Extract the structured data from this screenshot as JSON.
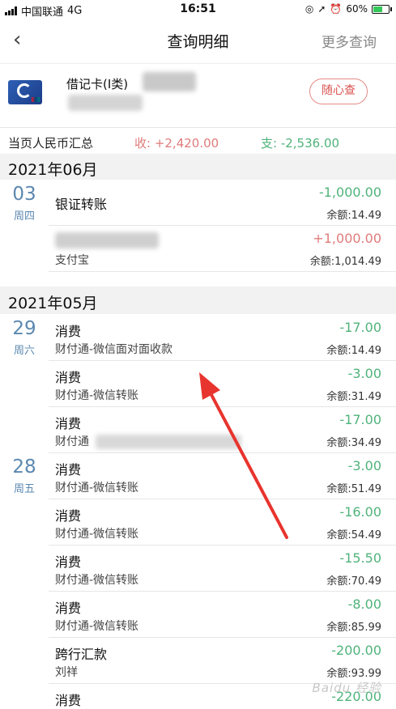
{
  "status_bar": {
    "carrier": "中国联通",
    "network": "4G",
    "time": "16:51",
    "battery_pct": "60%",
    "battery_level": 0.6
  },
  "nav": {
    "back_icon": "chevron-left-icon",
    "title": "查询明细",
    "more_label": "更多查询"
  },
  "card": {
    "name": "借记卡(Ⅰ类)",
    "button_label": "随心查"
  },
  "summary": {
    "label": "当页人民币汇总",
    "income": "收: +2,420.00",
    "expense": "支: -2,536.00"
  },
  "months": [
    {
      "label": "2021年06月",
      "days": [
        {
          "day": "03",
          "weekday": "周四",
          "items": [
            {
              "title": "银证转账",
              "subtitle": "",
              "amount": "-1,000.00",
              "balance": "余额:14.49"
            },
            {
              "title": "",
              "subtitle": "支付宝",
              "amount": "+1,000.00",
              "balance": "余额:1,014.49"
            }
          ]
        }
      ]
    },
    {
      "label": "2021年05月",
      "days": [
        {
          "day": "29",
          "weekday": "周六",
          "items": [
            {
              "title": "消费",
              "subtitle": "财付通-微信面对面收款",
              "amount": "-17.00",
              "balance": "余额:14.49"
            },
            {
              "title": "消费",
              "subtitle": "财付通-微信转账",
              "amount": "-3.00",
              "balance": "余额:31.49"
            },
            {
              "title": "消费",
              "subtitle": "财付通",
              "amount": "-17.00",
              "balance": "余额:34.49"
            }
          ]
        },
        {
          "day": "28",
          "weekday": "周五",
          "items": [
            {
              "title": "消费",
              "subtitle": "财付通-微信转账",
              "amount": "-3.00",
              "balance": "余额:51.49"
            },
            {
              "title": "消费",
              "subtitle": "财付通-微信转账",
              "amount": "-16.00",
              "balance": "余额:54.49"
            },
            {
              "title": "消费",
              "subtitle": "财付通-微信转账",
              "amount": "-15.50",
              "balance": "余额:70.49"
            },
            {
              "title": "消费",
              "subtitle": "财付通-微信转账",
              "amount": "-8.00",
              "balance": "余额:85.99"
            },
            {
              "title": "跨行汇款",
              "subtitle": "刘祥",
              "amount": "-200.00",
              "balance": "余额:93.99"
            },
            {
              "title": "消费",
              "subtitle": "",
              "amount": "-220.00",
              "balance": ""
            }
          ]
        }
      ]
    }
  ],
  "watermark": "Baidu 经验",
  "colors": {
    "income": "#e07b7b",
    "expense": "#4fb37a",
    "date": "#5b88b0",
    "accent_button": "#d9534f",
    "annotation_arrow": "#e8342e"
  }
}
